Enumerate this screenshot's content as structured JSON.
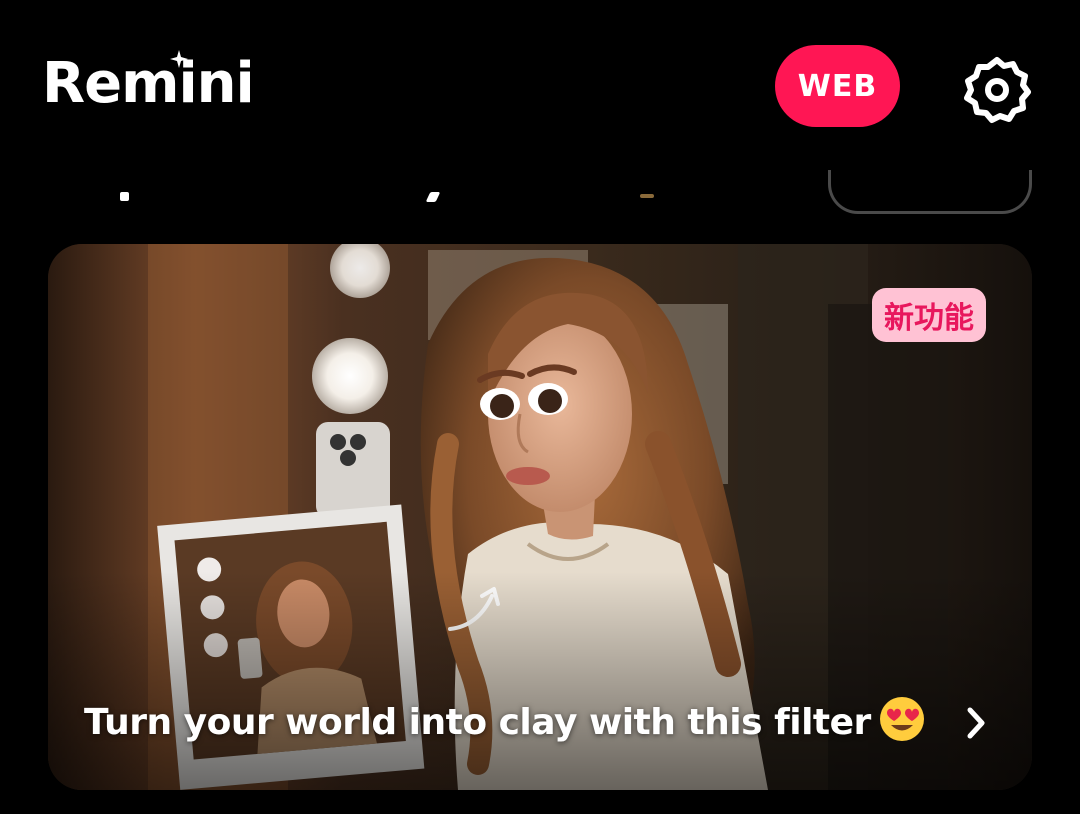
{
  "header": {
    "app_name": "Remini",
    "web_button_label": "WEB",
    "settings_icon": "gear-icon"
  },
  "feature_card": {
    "badge": "新功能",
    "caption": "Turn your world into clay with this filter",
    "emoji": "heart-eyes-emoji",
    "chevron_icon": "chevron-right-icon"
  },
  "colors": {
    "background": "#000000",
    "accent": "#ff1654",
    "badge_bg": "#ffc2d4",
    "badge_text": "#e8175d"
  }
}
